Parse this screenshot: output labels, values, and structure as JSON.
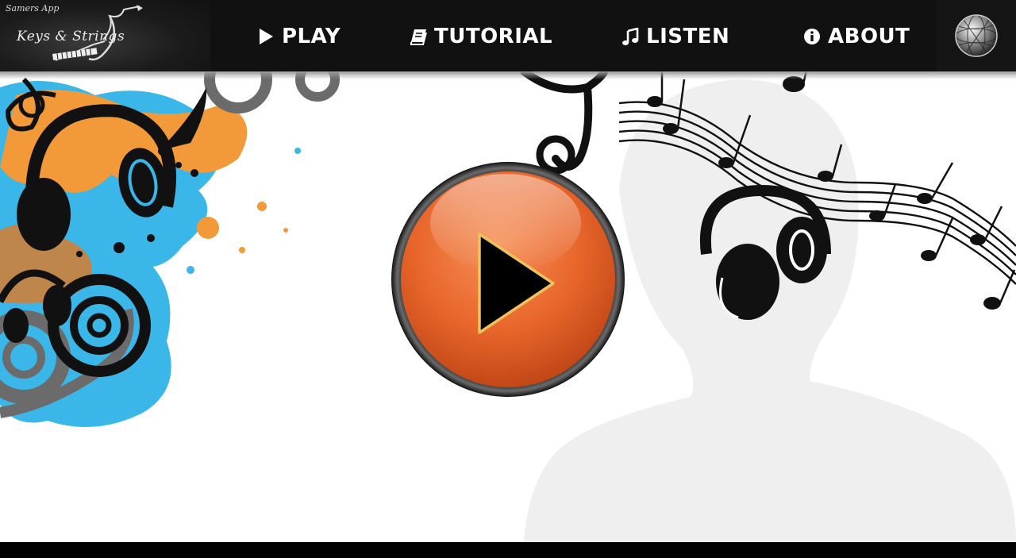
{
  "app": {
    "brand": "Samers App",
    "title": "Keys & Strings"
  },
  "nav": {
    "play_label": "PLAY",
    "tutorial_label": "TUTORIAL",
    "listen_label": "LISTEN",
    "about_label": "ABOUT"
  },
  "icons": {
    "play": "play-icon",
    "tutorial": "book-icon",
    "listen": "music-note-icon",
    "about": "info-icon",
    "globe": "globe-icon",
    "main_action": "play-button-icon"
  },
  "colors": {
    "navbar": "#111111",
    "accent_orange": "#e8652a",
    "splash_blue": "#3bb6e8",
    "splash_orange": "#f29a3a",
    "silhouette": "#ededed",
    "bottom_bar": "#000000"
  }
}
